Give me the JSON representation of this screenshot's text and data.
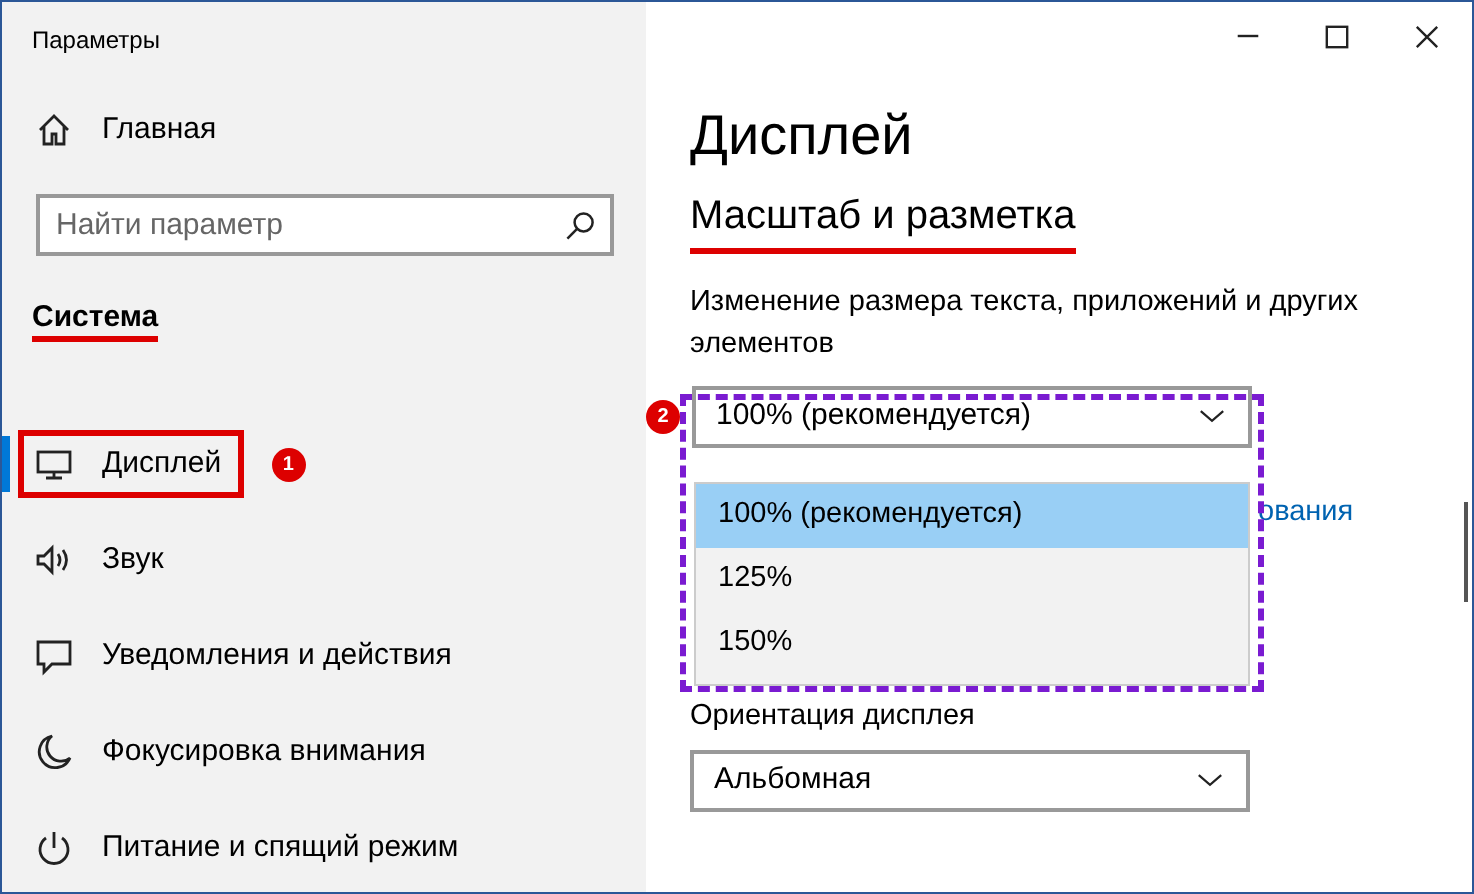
{
  "window": {
    "title": "Параметры"
  },
  "sidebar": {
    "home": "Главная",
    "search": {
      "placeholder": "Найти параметр"
    },
    "section": "Система",
    "items": [
      {
        "label": "Дисплей",
        "selected": true
      },
      {
        "label": "Звук",
        "selected": false
      },
      {
        "label": "Уведомления и действия",
        "selected": false
      },
      {
        "label": "Фокусировка внимания",
        "selected": false
      },
      {
        "label": "Питание и спящий режим",
        "selected": false
      }
    ]
  },
  "content": {
    "title": "Дисплей",
    "section": "Масштаб и разметка",
    "scale_label": "Изменение размера текста, приложений и других элементов",
    "scale_value": "100% (рекомендуется)",
    "scale_options": [
      {
        "label": "100% (рекомендуется)",
        "selected": true
      },
      {
        "label": "125%",
        "selected": false
      },
      {
        "label": "150%",
        "selected": false
      }
    ],
    "link_fragment": "ования",
    "orientation_label": "Ориентация дисплея",
    "orientation_value": "Альбомная"
  },
  "annotations": {
    "badges": [
      "1",
      "2"
    ]
  }
}
